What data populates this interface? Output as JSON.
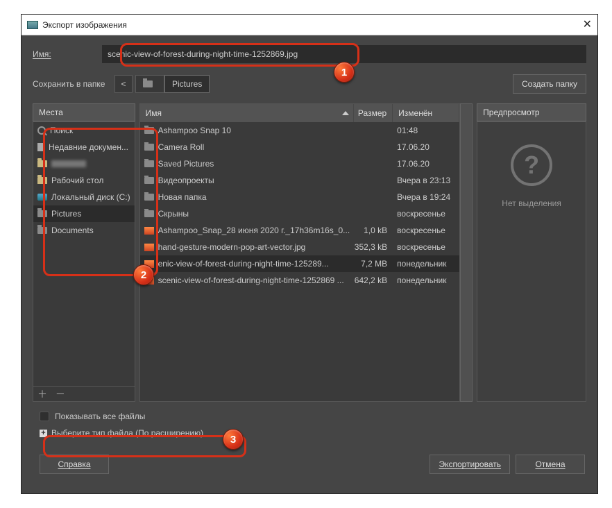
{
  "titlebar": {
    "title": "Экспорт изображения",
    "close": "✕"
  },
  "name": {
    "label": "Имя:",
    "value": "scenic-view-of-forest-during-night-time-1252869.jpg"
  },
  "path": {
    "label": "Сохранить в папке",
    "back": "<",
    "seg1_blur": "      ",
    "seg2": "Pictures"
  },
  "create_folder_btn": "Создать папку",
  "places": {
    "header": "Места",
    "items": [
      {
        "icon": "search",
        "label": "Поиск"
      },
      {
        "icon": "doc",
        "label": "Недавние докумен..."
      },
      {
        "icon": "folder",
        "label": ""
      },
      {
        "icon": "folder",
        "label": "Рабочий стол"
      },
      {
        "icon": "drive",
        "label": "Локальный диск (C:)"
      },
      {
        "icon": "folder-g",
        "label": "Pictures",
        "selected": true
      },
      {
        "icon": "folder-g",
        "label": "Documents"
      }
    ],
    "footer": "＋ －"
  },
  "filelist": {
    "headers": {
      "name": "Имя",
      "size": "Размер",
      "modified": "Изменён"
    },
    "rows": [
      {
        "icon": "folder-g",
        "name": "Ashampoo Snap 10",
        "size": "",
        "mod": "01:48"
      },
      {
        "icon": "folder-g",
        "name": "Camera Roll",
        "size": "",
        "mod": "17.06.20"
      },
      {
        "icon": "folder-g",
        "name": "Saved Pictures",
        "size": "",
        "mod": "17.06.20"
      },
      {
        "icon": "folder-g",
        "name": "Видеопроекты",
        "size": "",
        "mod": "Вчера в 23:13"
      },
      {
        "icon": "folder-g",
        "name": "Новая папка",
        "size": "",
        "mod": "Вчера в 19:24"
      },
      {
        "icon": "folder-g",
        "name": "Скрыны",
        "size": "",
        "mod": "воскресенье"
      },
      {
        "icon": "img",
        "name": "Ashampoo_Snap_28 июня 2020 г._17h36m16s_0...",
        "size": "1,0 kB",
        "mod": "воскресенье"
      },
      {
        "icon": "img",
        "name": "hand-gesture-modern-pop-art-vector.jpg",
        "size": "352,3 kB",
        "mod": "воскресенье"
      },
      {
        "icon": "img",
        "name": "enic-view-of-forest-during-night-time-125289...",
        "size": "7,2 MB",
        "mod": "понедельник",
        "selected": true
      },
      {
        "icon": "img",
        "name": "scenic-view-of-forest-during-night-time-1252869 ...",
        "size": "642,2 kB",
        "mod": "понедельник"
      }
    ]
  },
  "preview": {
    "header": "Предпросмотр",
    "empty": "Нет выделения",
    "q": "?"
  },
  "show_all": "Показывать все файлы",
  "filetype": {
    "expand": "+",
    "label": "Выберите тип файла (По расширению)"
  },
  "buttons": {
    "help": "Справка",
    "export": "Экспортировать",
    "cancel": "Отмена"
  },
  "badges": {
    "b1": "1",
    "b2": "2",
    "b3": "3"
  }
}
